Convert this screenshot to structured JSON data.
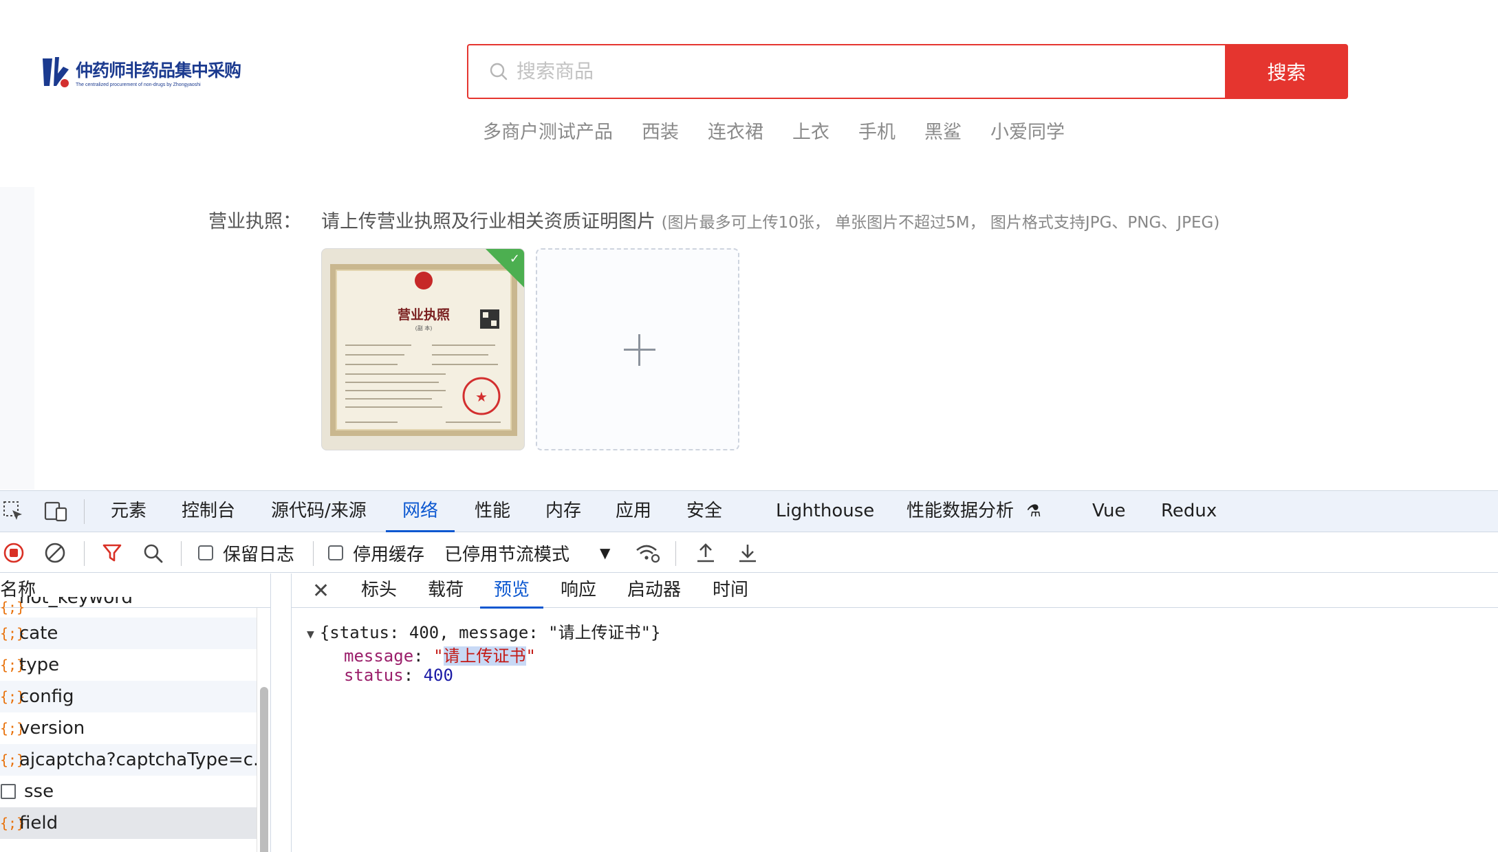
{
  "header": {
    "logo_title": "仲药师非药品集中采购",
    "logo_subtitle": "The centralized procurement of non-drugs by Zhongyaoshi",
    "search_placeholder": "搜索商品",
    "search_button": "搜索",
    "hot_words": [
      "多商户测试产品",
      "西装",
      "连衣裙",
      "上衣",
      "手机",
      "黑鲨",
      "小爱同学"
    ]
  },
  "license": {
    "label": "营业执照：",
    "hint_main": "请上传营业执照及行业相关资质证明图片",
    "hint_note": "(图片最多可上传10张， 单张图片不超过5M， 图片格式支持JPG、PNG、JPEG)",
    "cert_title": "营业执照",
    "cert_subtitle": "(副 本)"
  },
  "devtools": {
    "tabs": [
      "元素",
      "控制台",
      "源代码/来源",
      "网络",
      "性能",
      "内存",
      "应用",
      "安全",
      "Lighthouse",
      "性能数据分析",
      "Vue",
      "Redux"
    ],
    "active_tab": "网络",
    "toolbar": {
      "preserve_log": "保留日志",
      "disable_cache": "停用缓存",
      "throttle": "已停用节流模式"
    },
    "name_header": "名称",
    "requests": [
      {
        "name": "hot_keyword",
        "icon": "json-icon"
      },
      {
        "name": "cate",
        "icon": "json-icon"
      },
      {
        "name": "type",
        "icon": "json-icon"
      },
      {
        "name": "config",
        "icon": "json-icon"
      },
      {
        "name": "version",
        "icon": "json-icon"
      },
      {
        "name": "ajcaptcha?captchaType=c...",
        "icon": "json-icon"
      },
      {
        "name": "sse",
        "icon": "document-icon"
      },
      {
        "name": "field",
        "icon": "json-icon"
      }
    ],
    "detail_tabs": [
      "标头",
      "载荷",
      "预览",
      "响应",
      "启动器",
      "时间"
    ],
    "active_detail_tab": "预览",
    "preview": {
      "summary": "{status: 400, message: \"请上传证书\"}",
      "message_key": "message",
      "message_value": "请上传证书",
      "status_key": "status",
      "status_value": "400"
    }
  }
}
